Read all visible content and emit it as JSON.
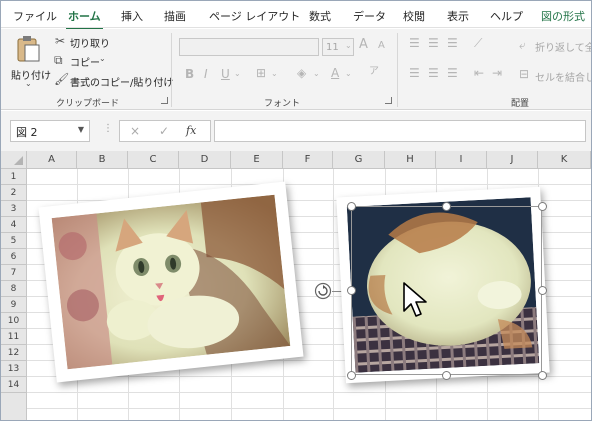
{
  "ribbon_tabs": [
    "ファイル",
    "ホーム",
    "挿入",
    "描画",
    "ページ レイアウト",
    "数式",
    "データ",
    "校閲",
    "表示",
    "ヘルプ",
    "図の形式"
  ],
  "active_tab": "ホーム",
  "clipboard": {
    "paste": "貼り付け",
    "cut": "切り取り",
    "copy": "コピー",
    "format_painter": "書式のコピー/貼り付け",
    "label": "クリップボード"
  },
  "font": {
    "size": "11",
    "bold": "B",
    "italic": "I",
    "underline": "U",
    "grow": "A",
    "shrink": "A",
    "label": "フォント"
  },
  "alignment": {
    "wrap": "折り返して全体",
    "merge": "セルを結合して",
    "label": "配置"
  },
  "formula_bar": {
    "name_box": "図 2",
    "cancel": "×",
    "enter": "✓",
    "fx": "fx",
    "formula": ""
  },
  "columns": [
    "A",
    "B",
    "C",
    "D",
    "E",
    "F",
    "G",
    "H",
    "I",
    "J",
    "K"
  ],
  "rows": [
    "1",
    "2",
    "3",
    "4",
    "5",
    "6",
    "7",
    "8",
    "9",
    "10",
    "11",
    "12",
    "13",
    "14"
  ],
  "pictures": [
    {
      "name": "cat-photo-1",
      "selected": false
    },
    {
      "name": "cat-photo-2",
      "selected": true
    }
  ],
  "accent_color": "#217346"
}
